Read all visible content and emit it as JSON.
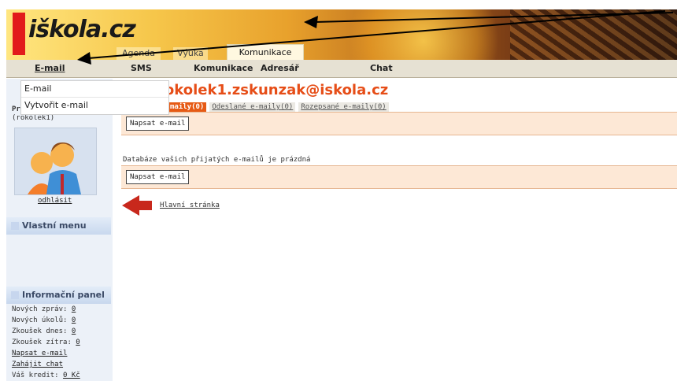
{
  "brand": {
    "logo_text": "iškola.cz"
  },
  "top_tabs": [
    {
      "label": "Agenda"
    },
    {
      "label": "Výuka"
    },
    {
      "label": "Komunikace"
    }
  ],
  "menu": [
    "E-mail",
    "SMS",
    "Komunikace",
    "Adresář",
    "Chat"
  ],
  "dropdown": [
    "E-mail",
    "Vytvořit e-mail"
  ],
  "sidebar": {
    "user_prefix": "Pr",
    "username": "(rokolek1)",
    "logout": "odhlásit",
    "own_menu": "Vlastní menu",
    "info_title": "Informační panel",
    "info": [
      {
        "label": "Nových zpráv:",
        "value": "0"
      },
      {
        "label": "Nových úkolů:",
        "value": "0"
      },
      {
        "label": "Zkoušek dnes:",
        "value": "0"
      },
      {
        "label": "Zkoušek zítra:",
        "value": "0"
      }
    ],
    "links": [
      "Napsat e-mail",
      "Zahájit chat"
    ],
    "credit_label": "Váš kredit:",
    "credit_value": "0 Kč"
  },
  "main": {
    "title": "rokolek1.zskunzak@iskola.cz",
    "title_prefix": ":",
    "tabs": [
      "maily(0)",
      "Odeslané e-maily(0)",
      "Rozepsané e-maily(0)"
    ],
    "compose": "Napsat e-mail",
    "empty": "Databáze vašich přijatých e-mailů je prázdná",
    "home": "Hlavní stránka"
  },
  "colors": {
    "accent": "#e64d17",
    "bar": "#fde8d6",
    "sidebar": "#ecf1f8"
  }
}
